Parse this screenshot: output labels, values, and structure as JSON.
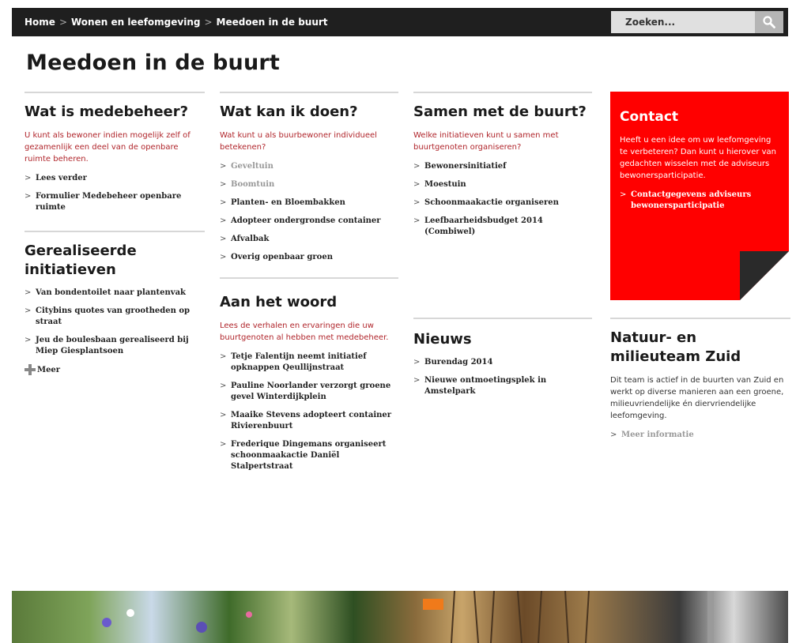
{
  "breadcrumb": {
    "items": [
      "Home",
      "Wonen en leefomgeving",
      "Meedoen in de buurt"
    ],
    "separator": ">"
  },
  "search": {
    "placeholder": "Zoeken..."
  },
  "page_title": "Meedoen in de buurt",
  "col1": {
    "section1": {
      "title": "Wat is medebeheer?",
      "intro": "U kunt als bewoner indien mogelijk zelf of gezamenlijk een deel van de openbare ruimte beheren.",
      "links": [
        "Lees verder",
        "Formulier Medebeheer openbare ruimte"
      ]
    },
    "section2": {
      "title": "Gerealiseerde initiatieven",
      "links": [
        "Van bondentoilet naar plantenvak",
        "Citybins quotes van grootheden op straat",
        "Jeu de boulesbaan gerealiseerd bij Miep Giesplantsoen"
      ],
      "more": "Meer"
    }
  },
  "col2": {
    "section1": {
      "title": "Wat kan ik doen?",
      "intro": "Wat kunt u als buurbewoner individueel betekenen?",
      "links": [
        "Geveltuin",
        "Boomtuin",
        "Planten- en Bloembakken",
        "Adopteer ondergrondse container",
        "Afvalbak",
        "Overig openbaar groen"
      ]
    },
    "section2": {
      "title": "Aan het woord",
      "intro": "Lees de verhalen en ervaringen die uw buurtgenoten al hebben met medebeheer.",
      "links": [
        "Tetje Falentijn neemt initiatief opknappen Qeullijnstraat",
        "Pauline Noorlander verzorgt groene gevel Winterdijkplein",
        "Maaike Stevens adopteert container Rivierenbuurt",
        "Frederique Dingemans organiseert schoonmaakactie Daniël Stalpertstraat"
      ]
    }
  },
  "col3": {
    "section1": {
      "title": "Samen met de buurt?",
      "intro": "Welke initiatieven kunt u samen met buurtgenoten organiseren?",
      "links": [
        "Bewonersinitiatief",
        "Moestuin",
        "Schoonmaakactie organiseren",
        "Leefbaarheidsbudget 2014 (Combiwel)"
      ]
    },
    "section2": {
      "title": "Nieuws",
      "links": [
        "Burendag 2014",
        "Nieuwe ontmoetingsplek in Amstelpark"
      ]
    }
  },
  "col4": {
    "contact": {
      "title": "Contact",
      "intro": "Heeft u een idee om uw leefomgeving te verbeteren? Dan kunt u hierover van gedachten wisselen met de adviseurs bewonersparticipatie.",
      "link": "Contactgegevens adviseurs bewonersparticipatie"
    },
    "section2": {
      "title": "Natuur- en milieuteam Zuid",
      "intro": "Dit team is actief in de buurten van Zuid en werkt op diverse manieren aan een groene, milieuvriendelijke én diervriendelijke leefomgeving.",
      "links": [
        "Meer informatie"
      ]
    }
  },
  "colors": {
    "topbar": "#1f1f1f",
    "accent_red": "#ff0000",
    "intro_text": "#b0252b"
  }
}
